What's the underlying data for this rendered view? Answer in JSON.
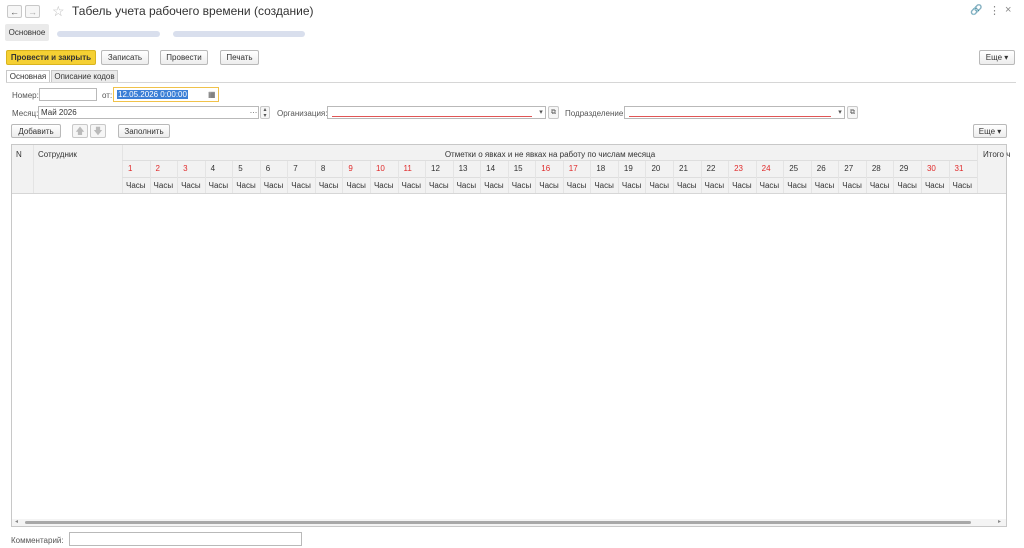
{
  "window": {
    "title": "Табель учета рабочего времени (создание)"
  },
  "subnav": {
    "tab": "Основное"
  },
  "toolbar": {
    "post_close": "Провести и закрыть",
    "write": "Записать",
    "post": "Провести",
    "print": "Печать",
    "more": "Еще"
  },
  "form_tabs": [
    {
      "label": "Основная"
    },
    {
      "label": "Описание кодов"
    }
  ],
  "fields": {
    "number_label": "Номер:",
    "from_label": "от:",
    "date_value": "12.05.2026  0:00:00",
    "month_label": "Месяц:",
    "month_value": "Май 2026",
    "org_label": "Организация:",
    "dept_label": "Подразделение:"
  },
  "table_toolbar": {
    "add": "Добавить",
    "fill": "Заполнить",
    "more": "Еще"
  },
  "table": {
    "col_n": "N",
    "col_employee": "Сотрудник",
    "col_marks": "Отметки о явках и не явках на работу по числам месяца",
    "col_total": "Итого ч",
    "hours_label": "Часы",
    "days": [
      {
        "d": "1",
        "red": true
      },
      {
        "d": "2",
        "red": true
      },
      {
        "d": "3",
        "red": true
      },
      {
        "d": "4",
        "red": false
      },
      {
        "d": "5",
        "red": false
      },
      {
        "d": "6",
        "red": false
      },
      {
        "d": "7",
        "red": false
      },
      {
        "d": "8",
        "red": false
      },
      {
        "d": "9",
        "red": true
      },
      {
        "d": "10",
        "red": true
      },
      {
        "d": "11",
        "red": true
      },
      {
        "d": "12",
        "red": false
      },
      {
        "d": "13",
        "red": false
      },
      {
        "d": "14",
        "red": false
      },
      {
        "d": "15",
        "red": false
      },
      {
        "d": "16",
        "red": true
      },
      {
        "d": "17",
        "red": true
      },
      {
        "d": "18",
        "red": false
      },
      {
        "d": "19",
        "red": false
      },
      {
        "d": "20",
        "red": false
      },
      {
        "d": "21",
        "red": false
      },
      {
        "d": "22",
        "red": false
      },
      {
        "d": "23",
        "red": true
      },
      {
        "d": "24",
        "red": true
      },
      {
        "d": "25",
        "red": false
      },
      {
        "d": "26",
        "red": false
      },
      {
        "d": "27",
        "red": false
      },
      {
        "d": "28",
        "red": false
      },
      {
        "d": "29",
        "red": false
      },
      {
        "d": "30",
        "red": true
      },
      {
        "d": "31",
        "red": true
      }
    ]
  },
  "footer": {
    "comment_label": "Комментарий:"
  },
  "colors": {
    "accent_yellow": "#f5d033",
    "weekend_red": "#e02b2b",
    "date_highlight": "#3b7fd6"
  }
}
